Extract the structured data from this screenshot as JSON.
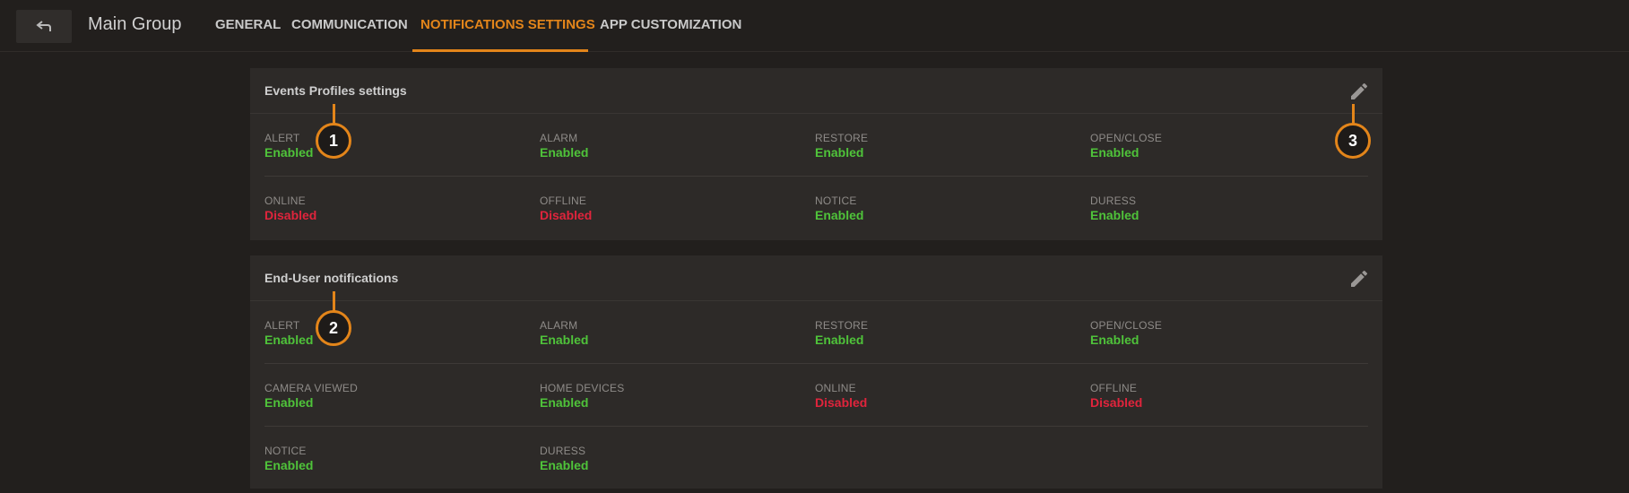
{
  "header": {
    "back_icon": "back-arrow-icon",
    "group_title": "Main Group",
    "tabs": [
      {
        "label": "GENERAL"
      },
      {
        "label": "COMMUNICATION"
      },
      {
        "label": "NOTIFICATIONS SETTINGS",
        "active": true
      },
      {
        "label": "APP CUSTOMIZATION"
      }
    ],
    "accent_color": "#e3851a"
  },
  "status_colors": {
    "enabled": "#4fc33a",
    "disabled": "#e0243c"
  },
  "panels": [
    {
      "title": "Events Profiles settings",
      "edit_icon": "pencil-icon",
      "rows": [
        [
          {
            "label": "ALERT",
            "value": "Enabled"
          },
          {
            "label": "ALARM",
            "value": "Enabled"
          },
          {
            "label": "RESTORE",
            "value": "Enabled"
          },
          {
            "label": "OPEN/CLOSE",
            "value": "Enabled"
          }
        ],
        [
          {
            "label": "ONLINE",
            "value": "Disabled"
          },
          {
            "label": "OFFLINE",
            "value": "Disabled"
          },
          {
            "label": "NOTICE",
            "value": "Enabled"
          },
          {
            "label": "DURESS",
            "value": "Enabled"
          }
        ]
      ]
    },
    {
      "title": "End-User notifications",
      "edit_icon": "pencil-icon",
      "rows": [
        [
          {
            "label": "ALERT",
            "value": "Enabled"
          },
          {
            "label": "ALARM",
            "value": "Enabled"
          },
          {
            "label": "RESTORE",
            "value": "Enabled"
          },
          {
            "label": "OPEN/CLOSE",
            "value": "Enabled"
          }
        ],
        [
          {
            "label": "CAMERA VIEWED",
            "value": "Enabled"
          },
          {
            "label": "HOME DEVICES",
            "value": "Enabled"
          },
          {
            "label": "ONLINE",
            "value": "Disabled"
          },
          {
            "label": "OFFLINE",
            "value": "Disabled"
          }
        ],
        [
          {
            "label": "NOTICE",
            "value": "Enabled"
          },
          {
            "label": "DURESS",
            "value": "Enabled"
          }
        ]
      ]
    }
  ],
  "callouts": [
    "1",
    "2",
    "3"
  ]
}
